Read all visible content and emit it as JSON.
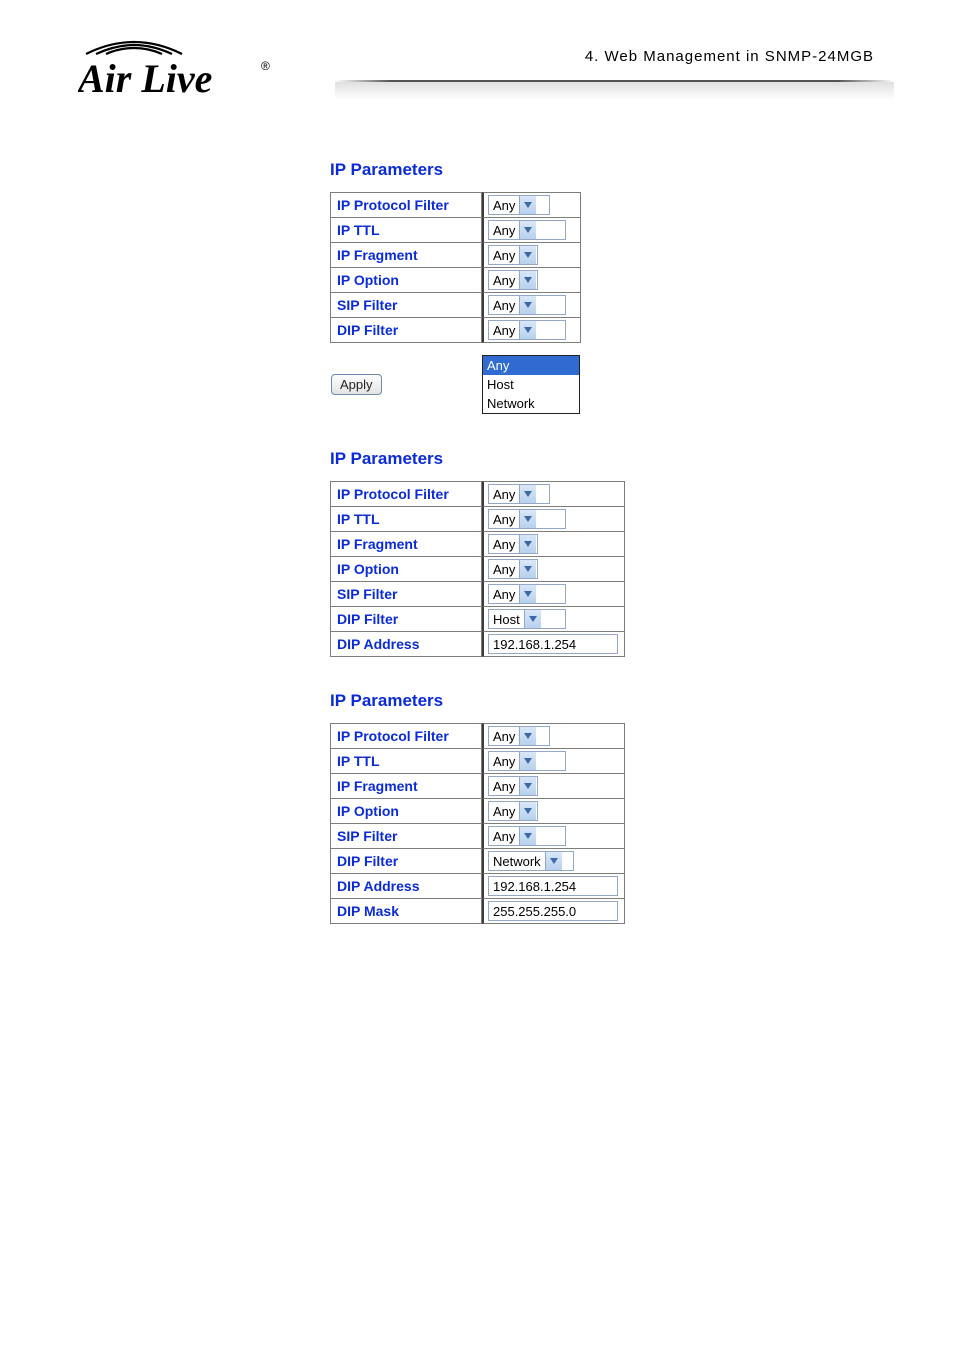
{
  "header_text": "4.  Web Management in SNMP-24MGB",
  "logo_text": "Air Live",
  "sections": [
    {
      "title": "IP Parameters",
      "apply_label": "Apply",
      "dropdown_options": [
        "Any",
        "Host",
        "Network"
      ],
      "rows": [
        {
          "label": "IP Protocol Filter",
          "value": "Any",
          "wclass": "w-a"
        },
        {
          "label": "IP TTL",
          "value": "Any",
          "wclass": "w-b"
        },
        {
          "label": "IP Fragment",
          "value": "Any",
          "wclass": "w-c"
        },
        {
          "label": "IP Option",
          "value": "Any",
          "wclass": "w-c"
        },
        {
          "label": "SIP Filter",
          "value": "Any",
          "wclass": "w-d"
        },
        {
          "label": "DIP Filter",
          "value": "Any",
          "wclass": "w-d"
        }
      ]
    },
    {
      "title": "IP Parameters",
      "rows": [
        {
          "label": "IP Protocol Filter",
          "value": "Any",
          "wclass": "w-a",
          "type": "select"
        },
        {
          "label": "IP TTL",
          "value": "Any",
          "wclass": "w-b",
          "type": "select"
        },
        {
          "label": "IP Fragment",
          "value": "Any",
          "wclass": "w-c",
          "type": "select"
        },
        {
          "label": "IP Option",
          "value": "Any",
          "wclass": "w-c",
          "type": "select"
        },
        {
          "label": "SIP Filter",
          "value": "Any",
          "wclass": "w-d",
          "type": "select"
        },
        {
          "label": "DIP Filter",
          "value": "Host",
          "wclass": "w-d",
          "type": "select"
        },
        {
          "label": "DIP Address",
          "value": "192.168.1.254",
          "type": "text"
        }
      ]
    },
    {
      "title": "IP Parameters",
      "rows": [
        {
          "label": "IP Protocol Filter",
          "value": "Any",
          "wclass": "w-a",
          "type": "select"
        },
        {
          "label": "IP TTL",
          "value": "Any",
          "wclass": "w-b",
          "type": "select"
        },
        {
          "label": "IP Fragment",
          "value": "Any",
          "wclass": "w-c",
          "type": "select"
        },
        {
          "label": "IP Option",
          "value": "Any",
          "wclass": "w-c",
          "type": "select"
        },
        {
          "label": "SIP Filter",
          "value": "Any",
          "wclass": "w-d",
          "type": "select"
        },
        {
          "label": "DIP Filter",
          "value": "Network",
          "wclass": "w-d",
          "type": "select"
        },
        {
          "label": "DIP Address",
          "value": "192.168.1.254",
          "type": "text"
        },
        {
          "label": "DIP Mask",
          "value": "255.255.255.0",
          "type": "text"
        }
      ]
    }
  ]
}
